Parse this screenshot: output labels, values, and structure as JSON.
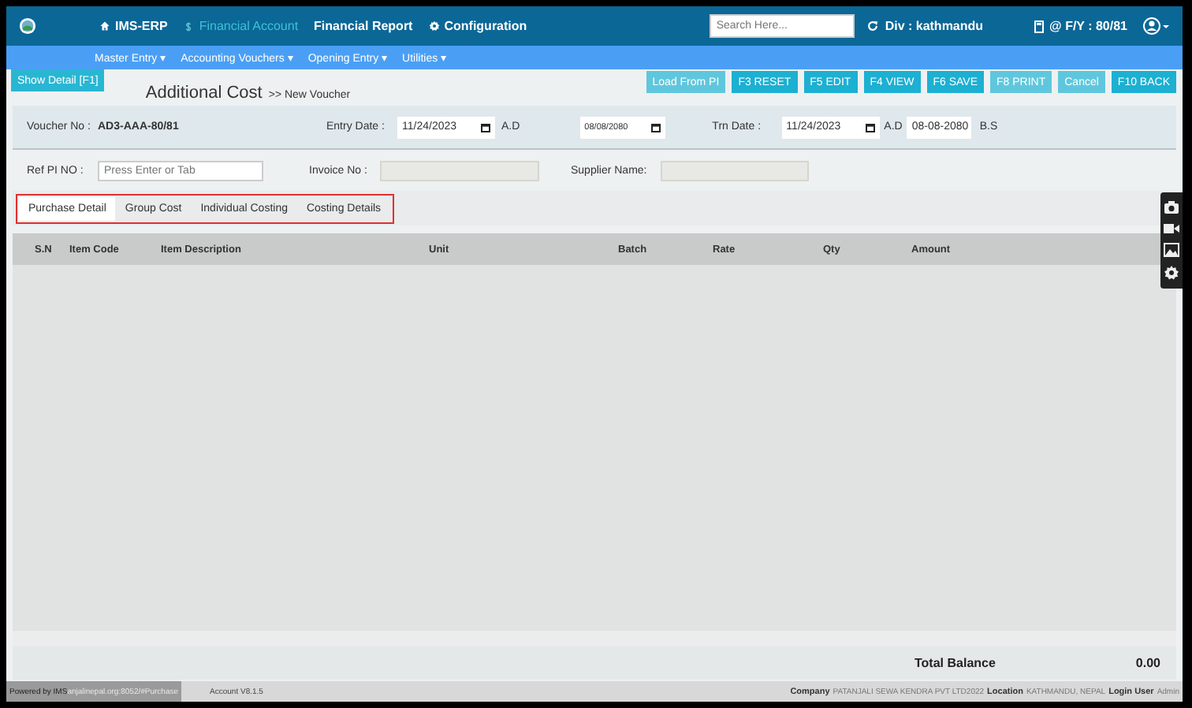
{
  "topbar": {
    "nav": [
      {
        "label": "IMS-ERP",
        "selected": false
      },
      {
        "label": "Financial Account",
        "selected": true
      },
      {
        "label": "Financial Report",
        "selected": false
      },
      {
        "label": "Configuration",
        "selected": false
      }
    ],
    "search": {
      "placeholder": "Search Here..."
    },
    "division": "Div : kathmandu",
    "fiscal_year": "@ F/Y : 80/81"
  },
  "menubar": [
    {
      "label": "Master Entry ▾"
    },
    {
      "label": "Accounting Vouchers ▾"
    },
    {
      "label": "Opening Entry ▾"
    },
    {
      "label": "Utilities ▾"
    }
  ],
  "toolbar": {
    "show_detail": "Show Detail [F1]",
    "title": "Additional Cost",
    "subtitle": ">> New Voucher",
    "buttons": [
      {
        "label": "Load From PI",
        "disabled": true
      },
      {
        "label": "F3 RESET",
        "disabled": false
      },
      {
        "label": "F5 EDIT",
        "disabled": false
      },
      {
        "label": "F4 VIEW",
        "disabled": false
      },
      {
        "label": "F6 SAVE",
        "disabled": false
      },
      {
        "label": "F8 PRINT",
        "disabled": true
      },
      {
        "label": "Cancel",
        "disabled": true
      },
      {
        "label": "F10 BACK",
        "disabled": false
      }
    ]
  },
  "form": {
    "voucher_no": {
      "label": "Voucher No :",
      "value": "AD3-AAA-80/81"
    },
    "entry_date": {
      "label": "Entry Date :",
      "value": "11/24/2023",
      "era": "A.D",
      "bs_value": "08/08/2080"
    },
    "trn_date": {
      "label": "Trn Date :",
      "value": "11/24/2023",
      "era": "A.D",
      "bs_value": "08-08-2080",
      "bs_era": "B.S"
    },
    "ref_pi": {
      "label": "Ref PI NO :",
      "placeholder": "Press Enter or Tab"
    },
    "invoice_no": {
      "label": "Invoice No :"
    },
    "supplier_name": {
      "label": "Supplier Name:"
    }
  },
  "tabs": [
    {
      "label": "Purchase Detail",
      "selected": true
    },
    {
      "label": "Group Cost",
      "selected": false
    },
    {
      "label": "Individual Costing",
      "selected": false
    },
    {
      "label": "Costing Details",
      "selected": false
    }
  ],
  "table": {
    "columns": [
      "S.N",
      "Item Code",
      "Item Description",
      "Unit",
      "Batch",
      "Rate",
      "Qty",
      "Amount"
    ]
  },
  "total": {
    "label": "Total Balance",
    "value": "0.00"
  },
  "footer": {
    "powered_by": "Powered by IMS",
    "url": "anjalinepal.org:8052/#Purchase",
    "version": "Account V8.1.5",
    "company_label": "Company",
    "company": "PATANJALI SEWA KENDRA PVT LTD2022",
    "location_label": "Location",
    "location": "KATHMANDU, NEPAL",
    "user_label": "Login User",
    "user": "Admin"
  }
}
